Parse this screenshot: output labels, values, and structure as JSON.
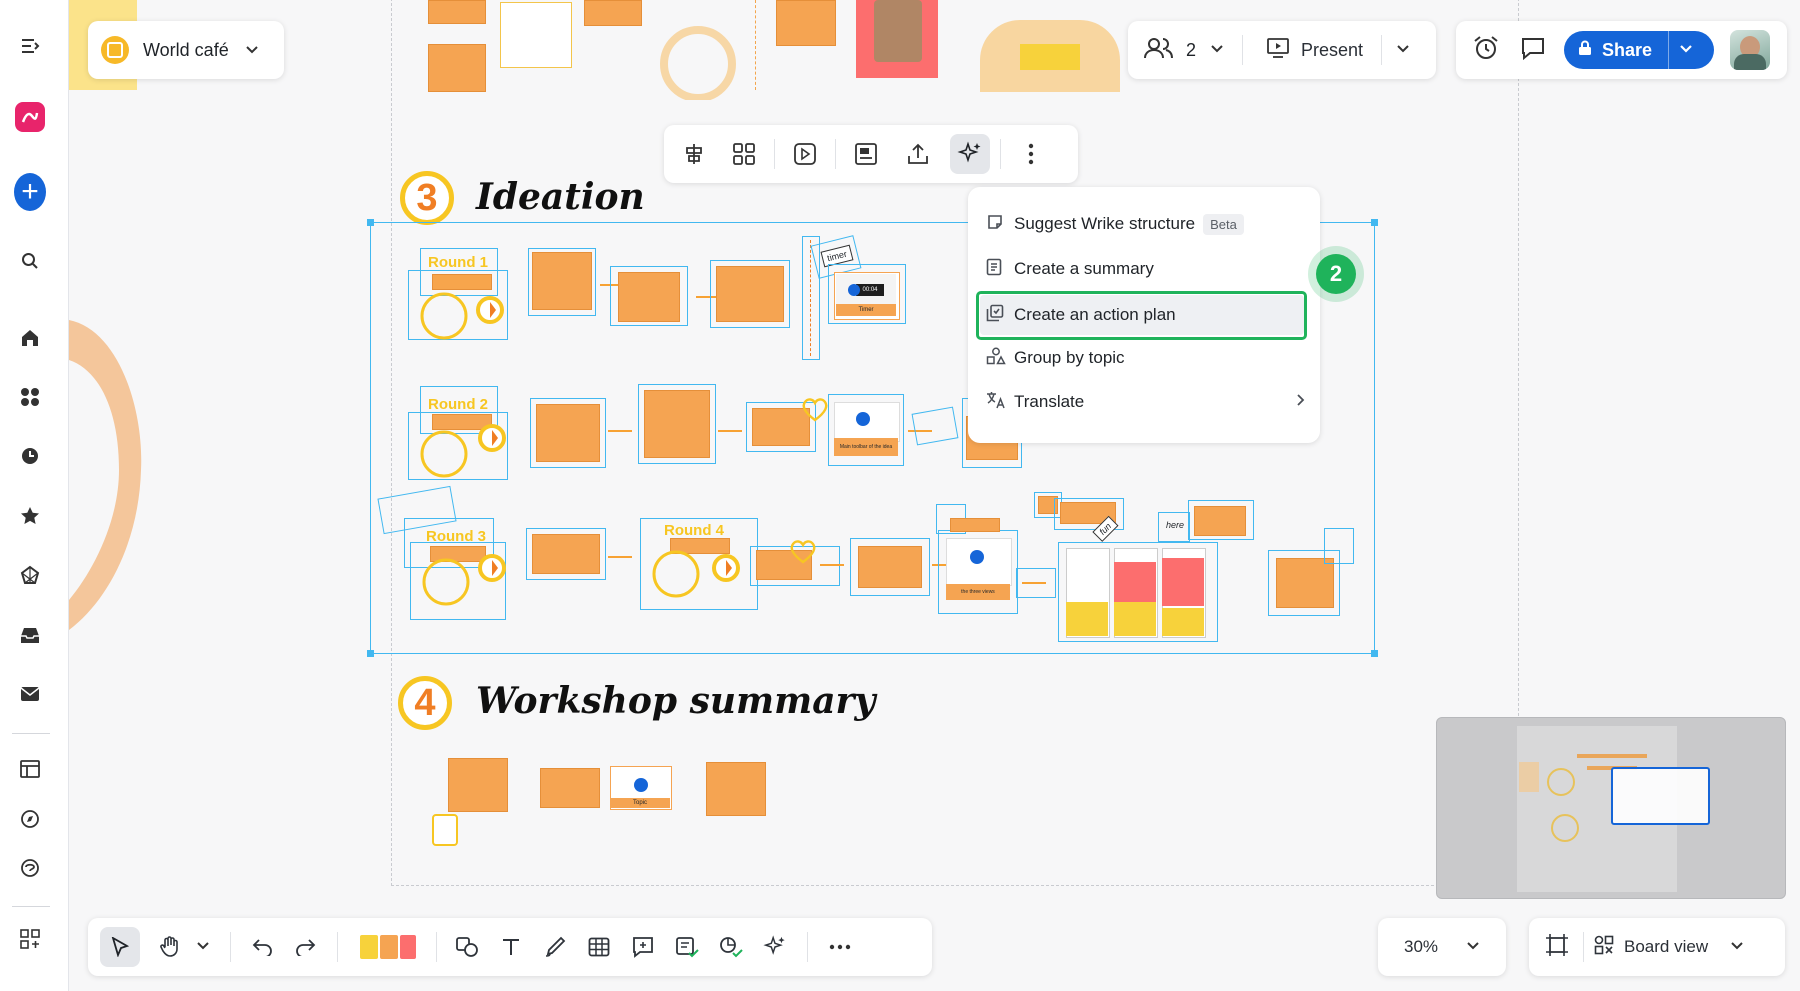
{
  "board": {
    "name": "World café"
  },
  "topbar": {
    "participants_count": "2",
    "present_label": "Present",
    "share_label": "Share"
  },
  "sections": [
    {
      "number": "3",
      "title": "Ideation"
    },
    {
      "number": "4",
      "title": "Workshop summary"
    }
  ],
  "ai_menu": {
    "items": [
      {
        "label": "Suggest Wrike structure",
        "badge": "Beta",
        "icon": "wrike-structure-icon"
      },
      {
        "label": "Create a summary",
        "icon": "document-icon"
      },
      {
        "label": "Create an action plan",
        "icon": "action-plan-icon",
        "highlighted": true
      },
      {
        "label": "Group by topic",
        "icon": "shapes-icon"
      },
      {
        "label": "Translate",
        "icon": "translate-icon",
        "has_submenu": true
      }
    ],
    "step_badge": "2"
  },
  "canvas_labels": {
    "round1": "Round 1",
    "round2": "Round 2",
    "round3": "Round 3",
    "round4": "Round 4",
    "timer": "timer",
    "fun": "fun",
    "here": "here",
    "timer_caption": "Timer",
    "main_toolbar_caption": "Main toolbar of the idea",
    "three_views": "the three views",
    "topic_caption": "Topic",
    "video_time": "00:04"
  },
  "bottom_bar": {
    "zoom": "30%",
    "view_label": "Board view"
  },
  "colors": {
    "accent": "#1565d8",
    "sticky": "#f5a452",
    "highlight": "#1fb35b",
    "selection": "#42b8f0"
  }
}
